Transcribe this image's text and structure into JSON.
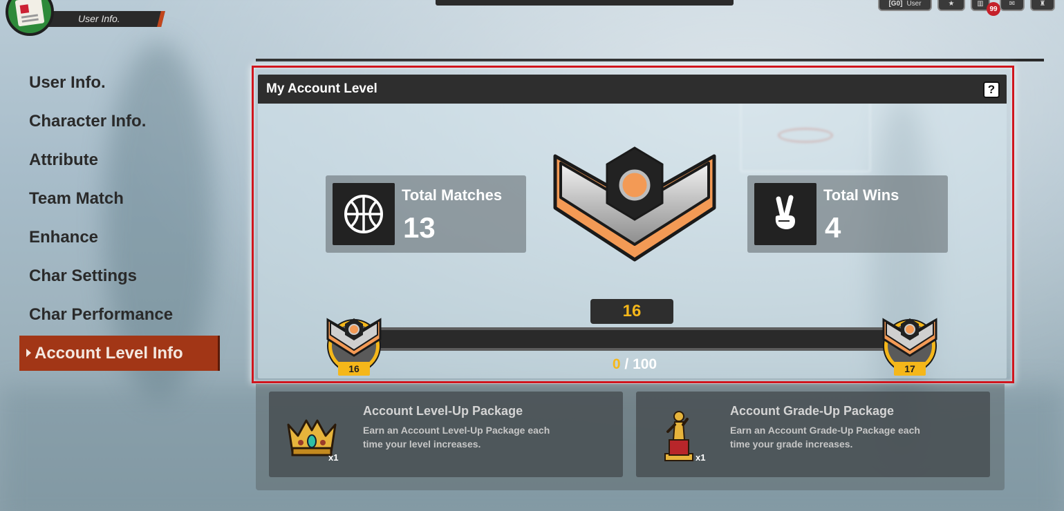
{
  "header": {
    "section_title": "User Info.",
    "user_badge_rank": "[G0]",
    "user_badge_label": "User",
    "notification_count": "99"
  },
  "menu": {
    "items": [
      {
        "label": "User Info."
      },
      {
        "label": "Character Info."
      },
      {
        "label": "Attribute"
      },
      {
        "label": "Team Match"
      },
      {
        "label": "Enhance"
      },
      {
        "label": "Char Settings"
      },
      {
        "label": "Char Performance"
      },
      {
        "label": "Account Level Info"
      }
    ],
    "active_index": 7
  },
  "panel": {
    "title": "My Account Level",
    "help_label": "?",
    "total_matches_label": "Total Matches",
    "total_matches_value": "13",
    "total_wins_label": "Total Wins",
    "total_wins_value": "4",
    "current_level": "16",
    "progress": {
      "current": "0",
      "separator": " / ",
      "max": "100",
      "fraction": 0
    },
    "from_level": "16",
    "to_level": "17"
  },
  "rewards": [
    {
      "title": "Account Level-Up Package",
      "description": "Earn an Account Level-Up Package each time your level increases.",
      "quantity": "x1",
      "icon": "crown-icon"
    },
    {
      "title": "Account Grade-Up Package",
      "description": "Earn an Account Grade-Up Package each time your grade increases.",
      "quantity": "x1",
      "icon": "trophy-icon"
    }
  ],
  "colors": {
    "accent": "#f5b71a",
    "active_menu": "#a23616",
    "highlight_border": "#d0151d",
    "emblem_orange": "#f39a55"
  }
}
